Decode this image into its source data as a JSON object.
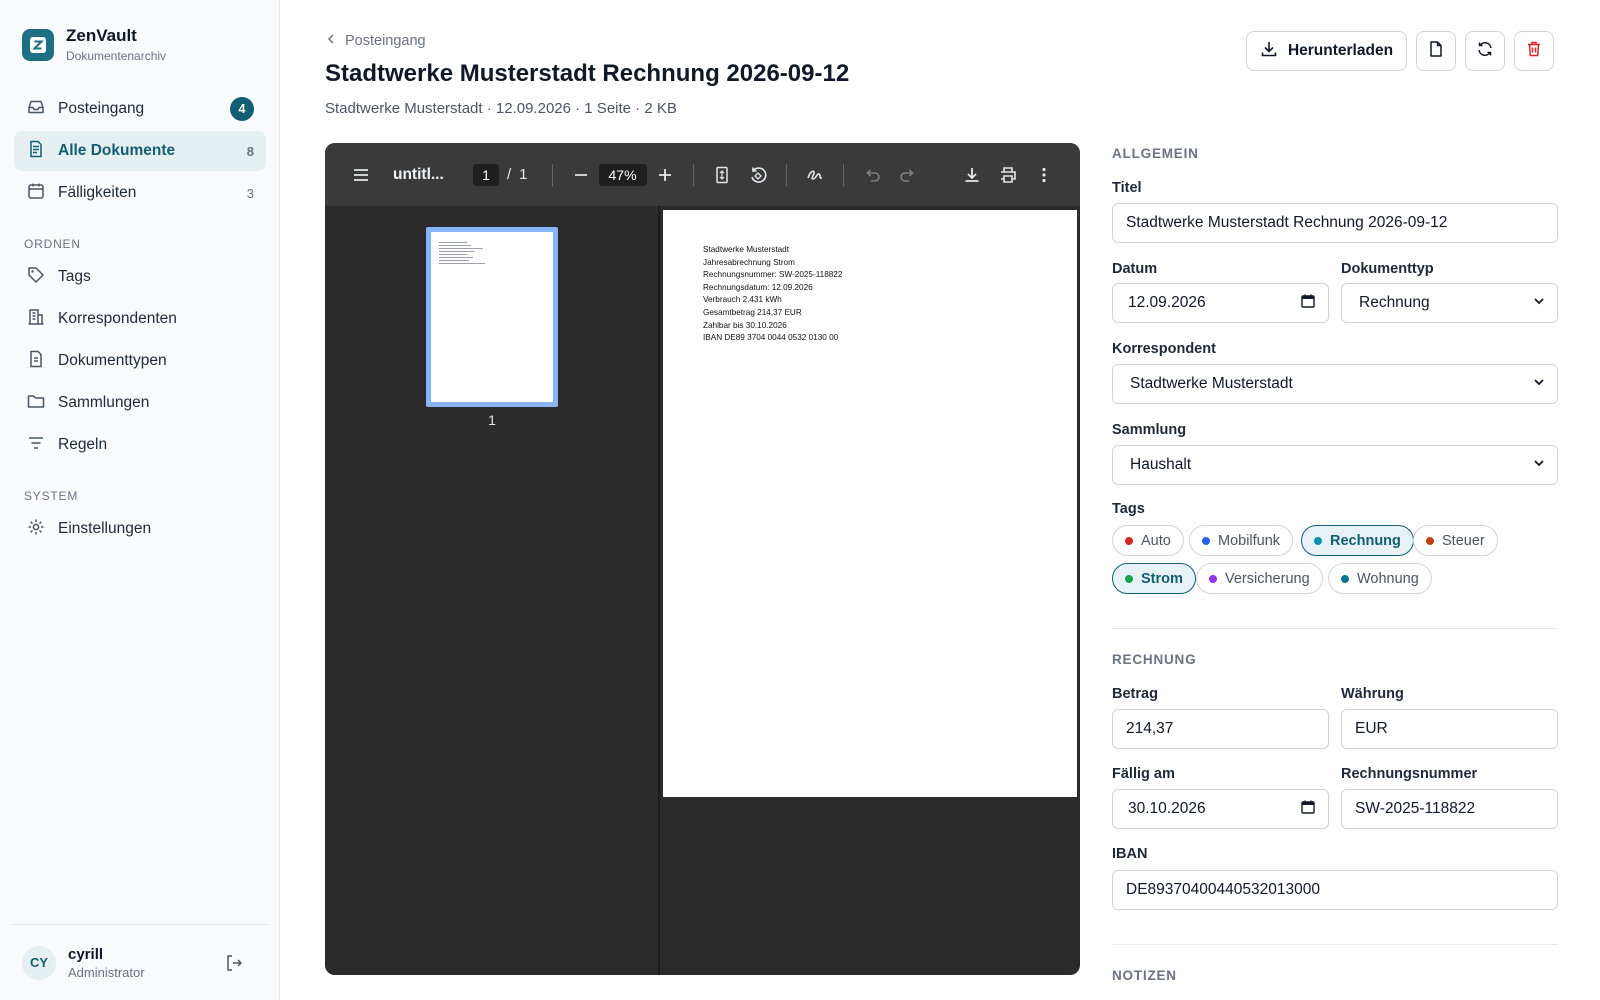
{
  "brand": {
    "name": "ZenVault",
    "subtitle": "Dokumentenarchiv"
  },
  "nav": {
    "items": [
      {
        "label": "Posteingang",
        "badge": "4"
      },
      {
        "label": "Alle Dokumente",
        "count": "8"
      },
      {
        "label": "Fälligkeiten",
        "count": "3"
      }
    ],
    "section_ordnen": "ORDNEN",
    "ordnen": [
      {
        "label": "Tags"
      },
      {
        "label": "Korrespondenten"
      },
      {
        "label": "Dokumenttypen"
      },
      {
        "label": "Sammlungen"
      },
      {
        "label": "Regeln"
      }
    ],
    "section_system": "SYSTEM",
    "system": [
      {
        "label": "Einstellungen"
      }
    ]
  },
  "user": {
    "initials": "CY",
    "name": "cyrill",
    "role": "Administrator"
  },
  "header": {
    "breadcrumb": "Posteingang",
    "title": "Stadtwerke Musterstadt Rechnung 2026-09-12",
    "meta": "Stadtwerke Musterstadt · 12.09.2026 · 1 Seite · 2 KB",
    "download_label": "Herunterladen"
  },
  "viewer": {
    "file_title": "untitl...",
    "page_current": "1",
    "page_sep": "/",
    "page_total": "1",
    "zoom": "47%",
    "thumb_label": "1",
    "doc_lines": [
      "Stadtwerke Musterstadt",
      "Jahresabrechnung Strom",
      "Rechnungsnummer: SW-2025-118822",
      "Rechnungsdatum: 12.09.2026",
      "Verbrauch 2.431 kWh",
      "Gesamtbetrag 214,37 EUR",
      "Zahlbar bis 30.10.2026",
      "IBAN DE89 3704 0044 0532 0130 00"
    ]
  },
  "form": {
    "section_allgemein": "ALLGEMEIN",
    "titel_label": "Titel",
    "titel_value": "Stadtwerke Musterstadt Rechnung 2026-09-12",
    "datum_label": "Datum",
    "datum_value": "12.09.2026",
    "doktyp_label": "Dokumenttyp",
    "doktyp_value": "Rechnung",
    "korr_label": "Korrespondent",
    "korr_value": "Stadtwerke Musterstadt",
    "samm_label": "Sammlung",
    "samm_value": "Haushalt",
    "tags_label": "Tags",
    "tags": [
      {
        "label": "Auto",
        "color": "#dc2626",
        "selected": false
      },
      {
        "label": "Mobilfunk",
        "color": "#2563eb",
        "selected": false
      },
      {
        "label": "Rechnung",
        "color": "#0891b2",
        "selected": true
      },
      {
        "label": "Steuer",
        "color": "#c2410c",
        "selected": false
      },
      {
        "label": "Strom",
        "color": "#16a34a",
        "selected": true
      },
      {
        "label": "Versicherung",
        "color": "#9333ea",
        "selected": false
      },
      {
        "label": "Wohnung",
        "color": "#0e7490",
        "selected": false
      }
    ],
    "section_rechnung": "RECHNUNG",
    "betrag_label": "Betrag",
    "betrag_value": "214,37",
    "waehrung_label": "Währung",
    "waehrung_value": "EUR",
    "faellig_label": "Fällig am",
    "faellig_value": "30.10.2026",
    "rnr_label": "Rechnungsnummer",
    "rnr_value": "SW-2025-118822",
    "iban_label": "IBAN",
    "iban_value": "DE89370400440532013000",
    "section_notizen": "NOTIZEN"
  }
}
